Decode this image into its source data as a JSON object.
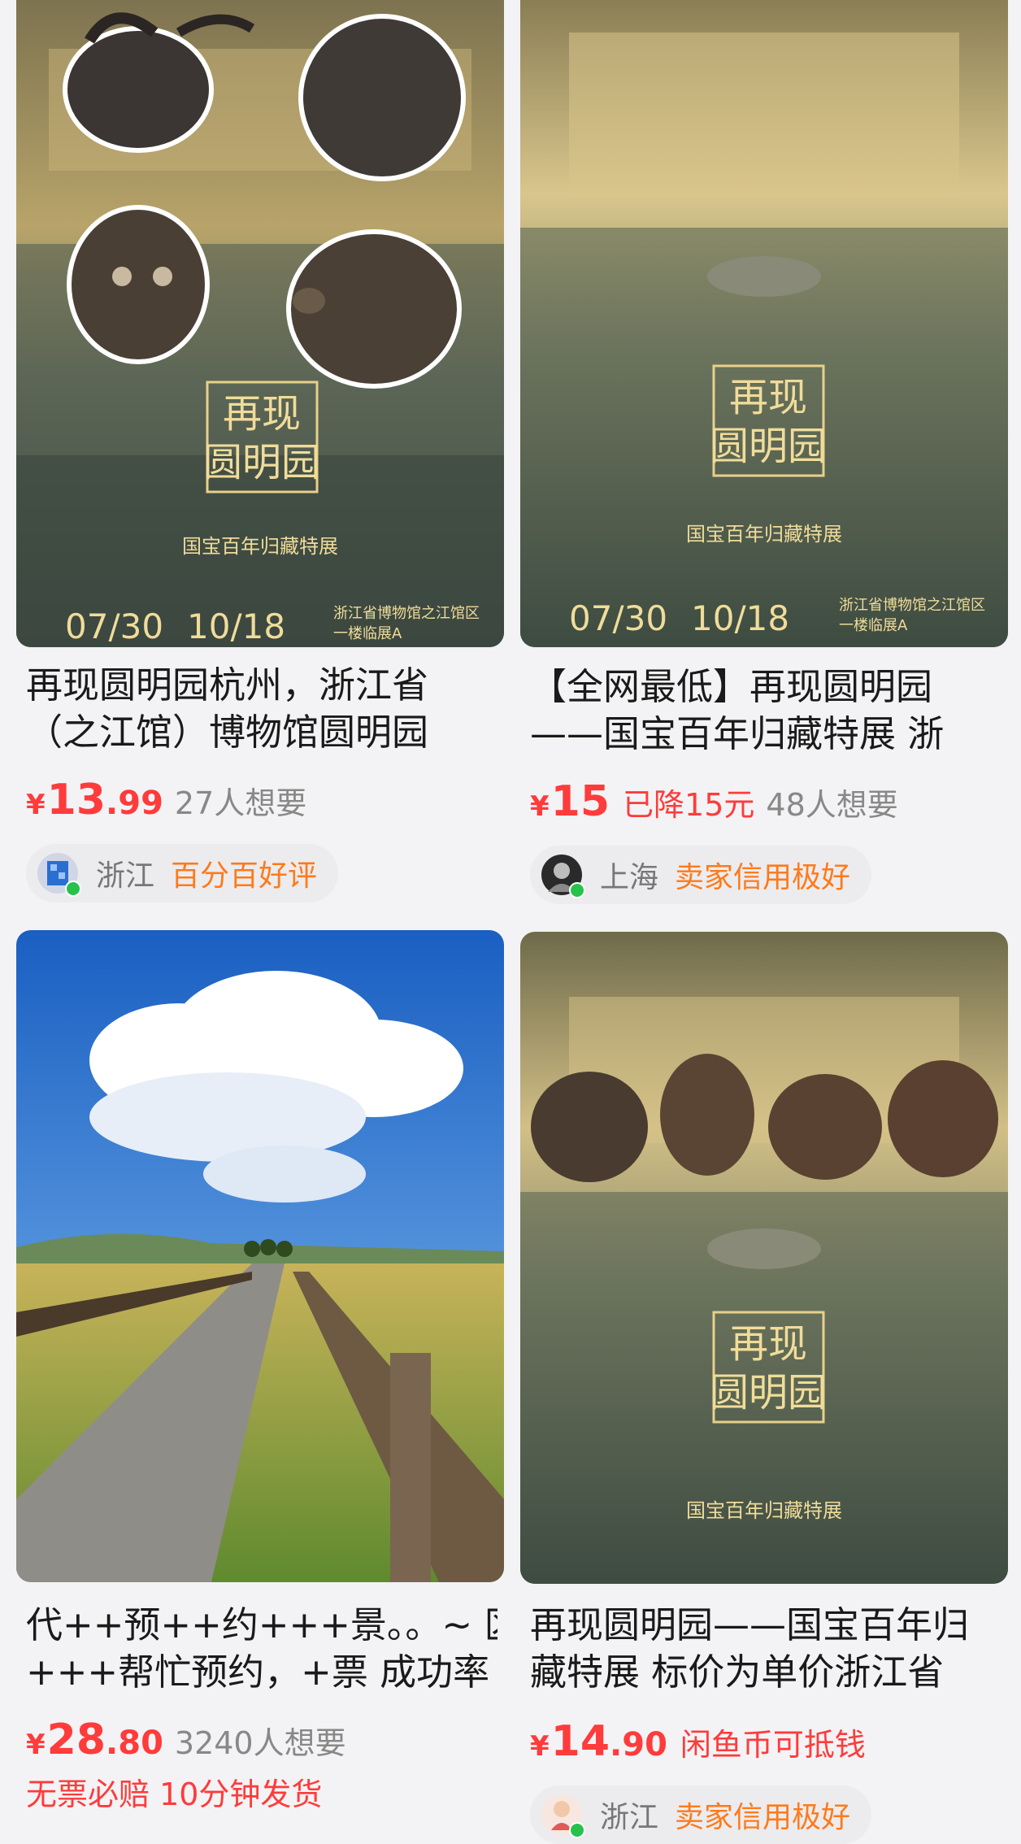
{
  "cards": [
    {
      "title_line1": "再现圆明园杭州，浙江省",
      "title_line2": "（之江馆）博物馆圆明园",
      "yen": "¥",
      "price_int": "13",
      "price_dec": ".99",
      "drop": "",
      "wants": "27人想要",
      "location": "浙江",
      "tag": "百分百好评",
      "poster": {
        "title1": "再现",
        "title2": "圆明园",
        "subtitle": "国宝百年归藏特展",
        "date_start": "07/30",
        "date_end": "10/18",
        "venue_line1": "浙江省博物馆之江馆区",
        "venue_line2": "一楼临展A"
      }
    },
    {
      "title_line1": "【全网最低】再现圆明园",
      "title_line2": "——国宝百年归藏特展 浙",
      "yen": "¥",
      "price_int": "15",
      "price_dec": "",
      "drop": "已降15元",
      "wants": "48人想要",
      "location": "上海",
      "tag": "卖家信用极好",
      "poster": {
        "title1": "再现",
        "title2": "圆明园",
        "subtitle": "国宝百年归藏特展",
        "date_start": "07/30",
        "date_end": "10/18",
        "venue_line1": "浙江省博物馆之江馆区",
        "venue_line2": "一楼临展A"
      }
    },
    {
      "title_line1": "代++预++约+++景。。~ 区",
      "title_line2": "+++帮忙预约，+票 成功率",
      "yen": "¥",
      "price_int": "28",
      "price_dec": ".80",
      "drop": "",
      "wants": "3240人想要",
      "promo": "无票必赔  10分钟发货"
    },
    {
      "title_line1": "再现圆明园——国宝百年归",
      "title_line2": "藏特展 标价为单价浙江省",
      "yen": "¥",
      "price_int": "14",
      "price_dec": ".90",
      "drop": "闲鱼币可抵钱",
      "wants": "",
      "location": "浙江",
      "tag": "卖家信用极好",
      "poster": {
        "title1": "再现",
        "title2": "圆明园",
        "subtitle": "国宝百年归藏特展"
      }
    }
  ],
  "colors": {
    "price_red": "#ff3b3b",
    "tag_orange": "#ff7a1a",
    "poster_gold": "#e8d08a",
    "poster_green": "#4a5a4c",
    "online_dot": "#27c24c"
  }
}
